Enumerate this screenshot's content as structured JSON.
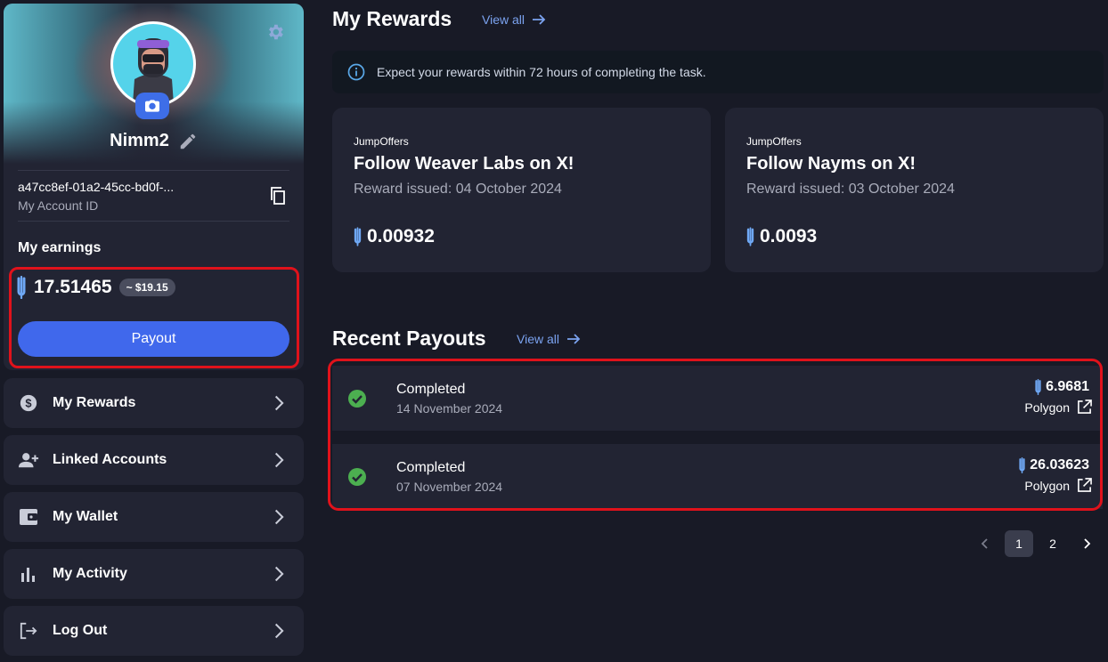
{
  "profile": {
    "username": "Nimm2",
    "account_id": "a47cc8ef-01a2-45cc-bd0f-...",
    "account_id_label": "My Account ID"
  },
  "earnings": {
    "title": "My earnings",
    "amount": "17.51465",
    "usd": "~ $19.15",
    "payout_label": "Payout"
  },
  "menu": [
    {
      "label": "My Rewards",
      "icon": "dollar-circle-icon"
    },
    {
      "label": "Linked Accounts",
      "icon": "person-add-icon"
    },
    {
      "label": "My Wallet",
      "icon": "wallet-icon"
    },
    {
      "label": "My Activity",
      "icon": "bar-chart-icon"
    },
    {
      "label": "Log Out",
      "icon": "logout-icon"
    }
  ],
  "rewards": {
    "title": "My Rewards",
    "view_all": "View all",
    "info": "Expect your rewards within 72 hours of completing the task.",
    "cards": [
      {
        "brand": "JumpOffers",
        "title": "Follow Weaver Labs on X!",
        "issued": "Reward issued: 04 October 2024",
        "amount": "0.00932"
      },
      {
        "brand": "JumpOffers",
        "title": "Follow Nayms on X!",
        "issued": "Reward issued: 03 October 2024",
        "amount": "0.0093"
      }
    ]
  },
  "payouts": {
    "title": "Recent Payouts",
    "view_all": "View all",
    "rows": [
      {
        "status": "Completed",
        "date": "14 November 2024",
        "amount": "6.9681",
        "network": "Polygon"
      },
      {
        "status": "Completed",
        "date": "07 November 2024",
        "amount": "26.03623",
        "network": "Polygon"
      }
    ]
  },
  "pagination": {
    "pages": [
      "1",
      "2"
    ],
    "current": "1"
  },
  "colors": {
    "accent": "#4068ec",
    "link": "#7ba3f0",
    "success": "#4caf50",
    "highlight": "#e0121b",
    "token": "#6fa8f5"
  }
}
